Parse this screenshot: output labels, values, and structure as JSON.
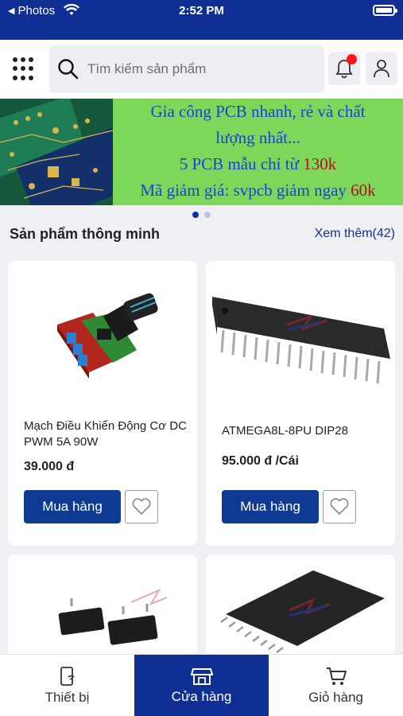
{
  "status_bar": {
    "back_label": "Photos",
    "time": "2:52 PM"
  },
  "header": {
    "search_placeholder": "Tìm kiếm sản phẩm"
  },
  "banner": {
    "line1": "Gia công PCB nhanh, rẻ và chất",
    "line2": "lượng nhất...",
    "line3_prefix": "5 PCB mẫu chỉ từ ",
    "line3_price": "130k",
    "line4_prefix": "Mã giảm giá: svpcb giảm ngay ",
    "line4_amount": "60k",
    "slides_total": 2,
    "active_slide": 1
  },
  "section": {
    "title": "Sản phẩm thông minh",
    "see_more": "Xem thêm(42)"
  },
  "products": [
    {
      "name": "Mạch Điều Khiển Động Cơ DC PWM 5A 90W",
      "price": "39.000 đ",
      "buy_label": "Mua hàng"
    },
    {
      "name": "ATMEGA8L-8PU DIP28",
      "price": "95.000 đ /Cái",
      "buy_label": "Mua hàng"
    }
  ],
  "tabs": [
    {
      "label": "Thiết bị",
      "icon": "device-icon",
      "active": false
    },
    {
      "label": "Cửa hàng",
      "icon": "store-icon",
      "active": true
    },
    {
      "label": "Giỏ hàng",
      "icon": "cart-icon",
      "active": false
    }
  ],
  "colors": {
    "brand": "#0f2f95",
    "button": "#0f3a93",
    "banner_bg": "#7dd85a",
    "banner_text": "#1f3fd8",
    "banner_accent": "#b0121a",
    "notification": "#ff1515"
  }
}
